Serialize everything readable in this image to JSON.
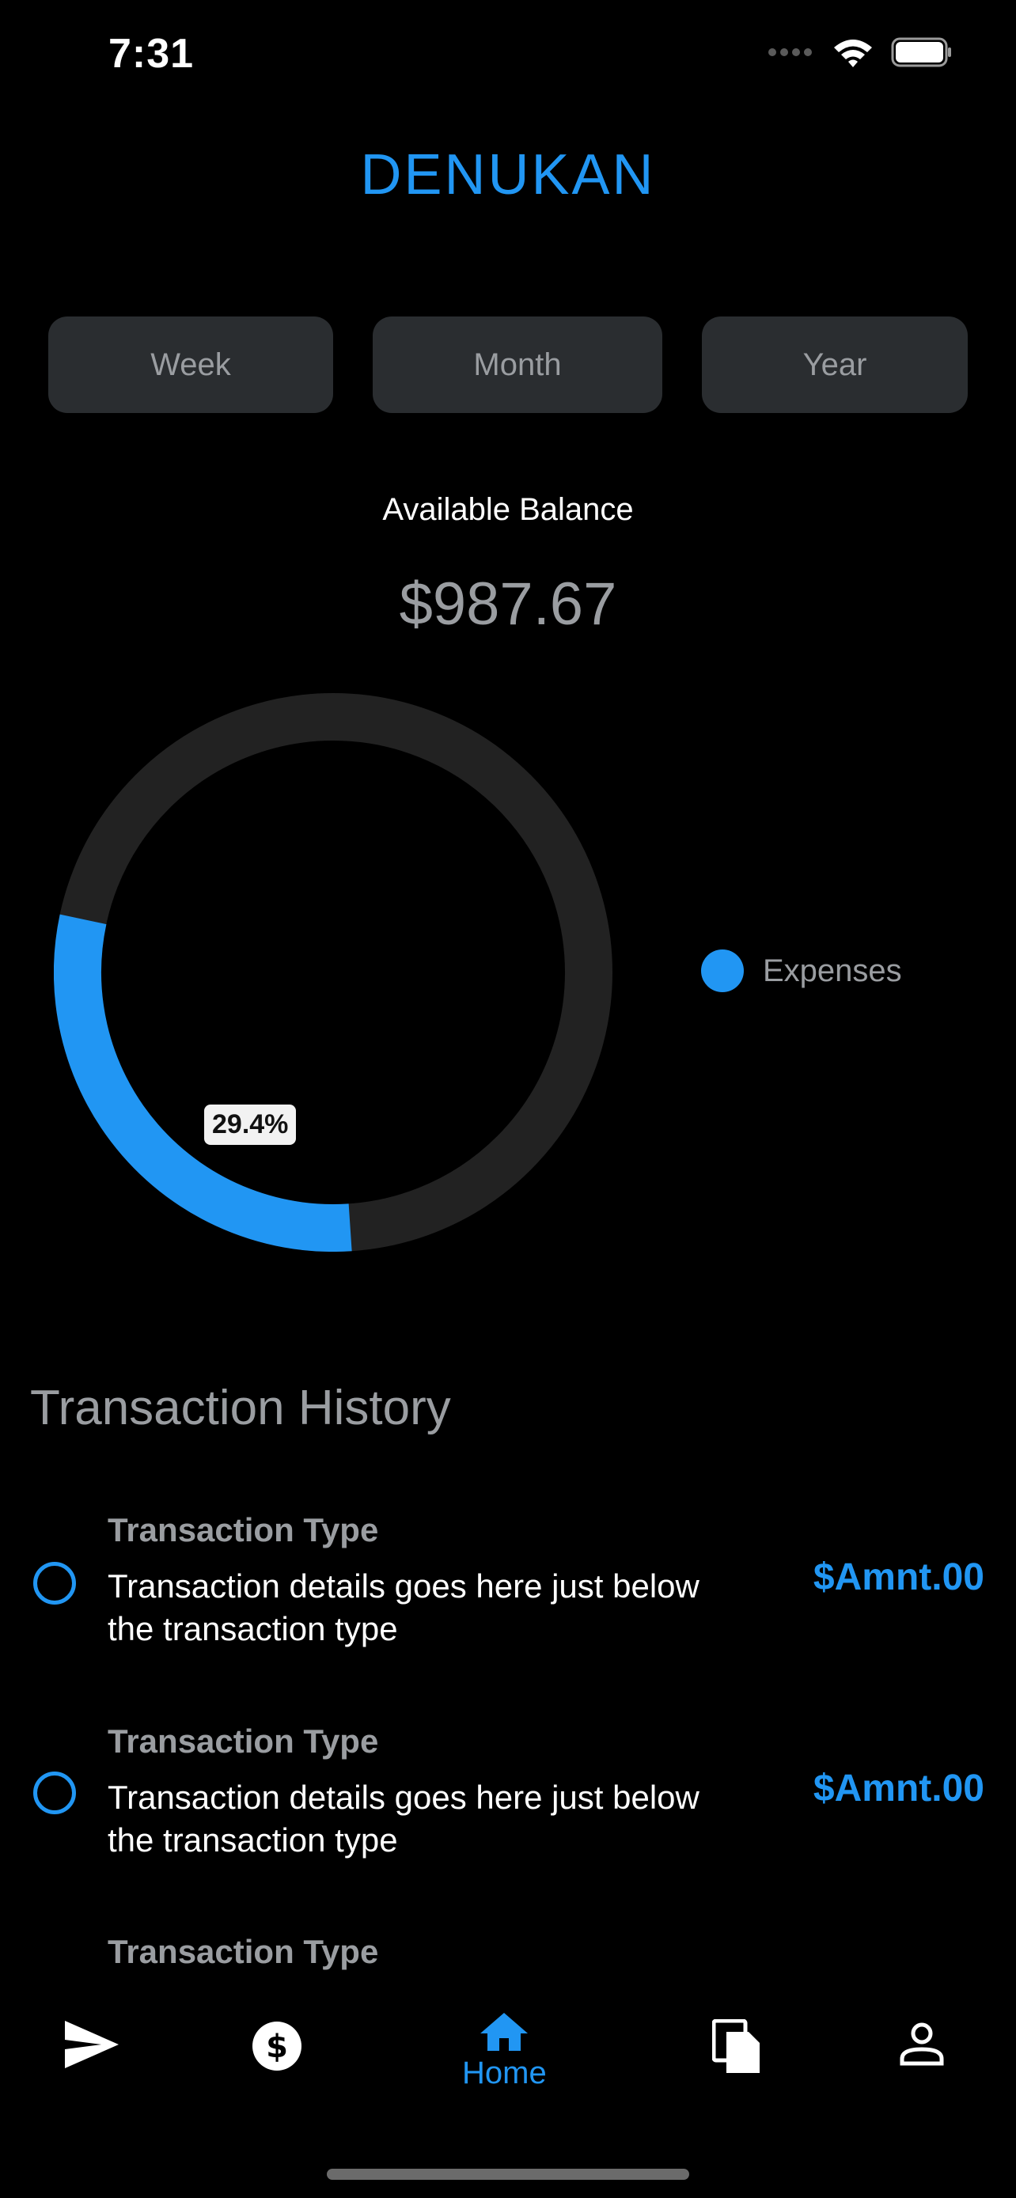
{
  "status_bar": {
    "time": "7:31"
  },
  "app": {
    "title": "DENUKAN"
  },
  "periods": [
    "Week",
    "Month",
    "Year"
  ],
  "balance": {
    "label": "Available Balance",
    "amount": "$987.67"
  },
  "chart": {
    "type": "donut",
    "percent_label": "29.4%",
    "expenses_fraction": 0.294,
    "legend": "Expenses",
    "colors": {
      "expenses": "#2196F3",
      "remainder": "#222222"
    }
  },
  "history": {
    "title": "Transaction History",
    "items": [
      {
        "type": "Transaction Type",
        "details": "Transaction details goes here just below the transaction type",
        "amount": "$Amnt.00"
      },
      {
        "type": "Transaction Type",
        "details": "Transaction details goes here just below the transaction type",
        "amount": "$Amnt.00"
      },
      {
        "type": "Transaction Type",
        "details": "",
        "amount": ""
      }
    ]
  },
  "nav": {
    "items": [
      {
        "icon": "send-icon"
      },
      {
        "icon": "dollar-icon"
      },
      {
        "icon": "home-icon",
        "label": "Home",
        "active": true
      },
      {
        "icon": "documents-icon"
      },
      {
        "icon": "profile-icon"
      }
    ]
  },
  "colors": {
    "accent": "#2196F3",
    "muted_text": "#9a9da1",
    "button_bg": "#2a2d30"
  }
}
